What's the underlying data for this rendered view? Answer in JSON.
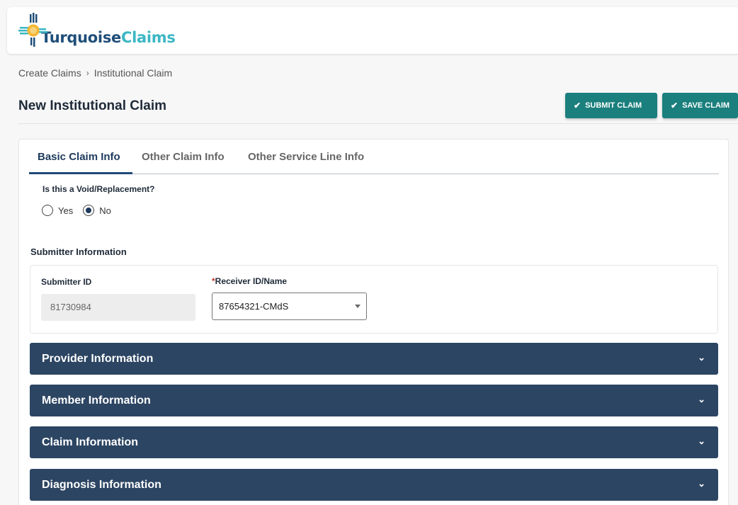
{
  "app": {
    "logo_text_part1": "Turquoise",
    "logo_text_part2": "Claims"
  },
  "breadcrumb": {
    "items": [
      "Create Claims",
      "Institutional Claim"
    ],
    "separator": "›"
  },
  "page": {
    "title": "New Institutional Claim"
  },
  "actions": {
    "submit_label": "SUBMIT CLAIM",
    "save_label": "SAVE CLAIM",
    "accent_color": "#1a7f7d"
  },
  "tabs": [
    {
      "label": "Basic Claim Info",
      "active": true
    },
    {
      "label": "Other Claim Info",
      "active": false
    },
    {
      "label": "Other Service Line Info",
      "active": false
    }
  ],
  "void_replacement": {
    "question": "Is this a Void/Replacement?",
    "options": [
      "Yes",
      "No"
    ],
    "selected": "No"
  },
  "submitter": {
    "section_title": "Submitter Information",
    "submitter_id_label": "Submitter ID",
    "submitter_id_value": "81730984",
    "receiver_required_mark": "*",
    "receiver_label": "Receiver ID/Name",
    "receiver_value": "87654321-CMdS"
  },
  "sections": [
    "Provider Information",
    "Member Information",
    "Claim Information",
    "Diagnosis Information"
  ],
  "colors": {
    "section_header_bg": "#2c4563",
    "logo_navy": "#1f4e79",
    "logo_teal": "#3bb7c4"
  }
}
